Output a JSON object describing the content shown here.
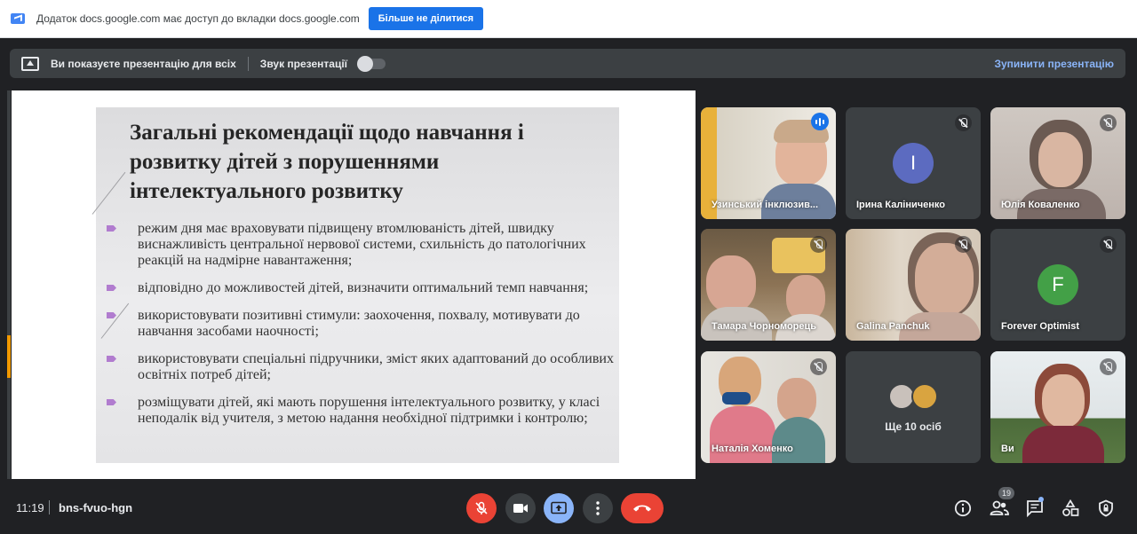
{
  "share_bar": {
    "message": "Додаток docs.google.com має доступ до вкладки docs.google.com",
    "stop_button": "Більше не ділитися"
  },
  "present_bar": {
    "presenting_label": "Ви показуєте презентацію для всіх",
    "sound_label": "Звук презентації",
    "sound_enabled": false,
    "stop_label": "Зупинити презентацію"
  },
  "slide": {
    "title": "Загальні рекомендації щодо навчання і розвитку дітей з порушеннями інтелектуального розвитку",
    "bullets": [
      "режим дня має враховувати підвищену втомлюваність дітей, швидку виснажливість центральної нервової системи, схильність до патологічних реакцій на надмірне навантаження;",
      "відповідно до можливостей дітей, визначити оптимальний темп навчання;",
      "використовувати позитивні стимули: заохочення, похвалу, мотивувати до навчання засобами наочності;",
      "використовувати спеціальні підручники, зміст яких адаптований до особливих освітніх потреб дітей;",
      "розміщувати дітей, які мають порушення інтелектуального розвитку, у класі неподалік від учителя, з метою надання необхідної підтримки і контролю;"
    ]
  },
  "participants": [
    {
      "name": "Узинський інклюзив..."
    },
    {
      "name": "Ірина Каліниченко",
      "initial": "І",
      "color": "#5c6bc0"
    },
    {
      "name": "Юлія Коваленко"
    },
    {
      "name": "Тамара Чорноморець"
    },
    {
      "name": "Galina Panchuk"
    },
    {
      "name": "Forever Optimist",
      "initial": "F",
      "color": "#43a047"
    },
    {
      "name": "Наталія Хоменко"
    },
    {
      "name": "Ще 10 осіб"
    },
    {
      "name": "Ви"
    }
  ],
  "bottom_bar": {
    "time": "11:19",
    "meeting_code": "bns-fvuo-hgn",
    "participant_count": "19"
  },
  "colors": {
    "background": "#202124",
    "accent_blue": "#1a73e8",
    "danger_red": "#ea4335",
    "link_blue": "#8ab4f8"
  },
  "icons": [
    "share-tab-icon",
    "present-screen-icon",
    "mic-off-icon",
    "camera-icon",
    "present-icon",
    "more-options-icon",
    "hang-up-icon",
    "info-icon",
    "people-icon",
    "chat-icon",
    "activities-icon",
    "host-controls-icon"
  ]
}
